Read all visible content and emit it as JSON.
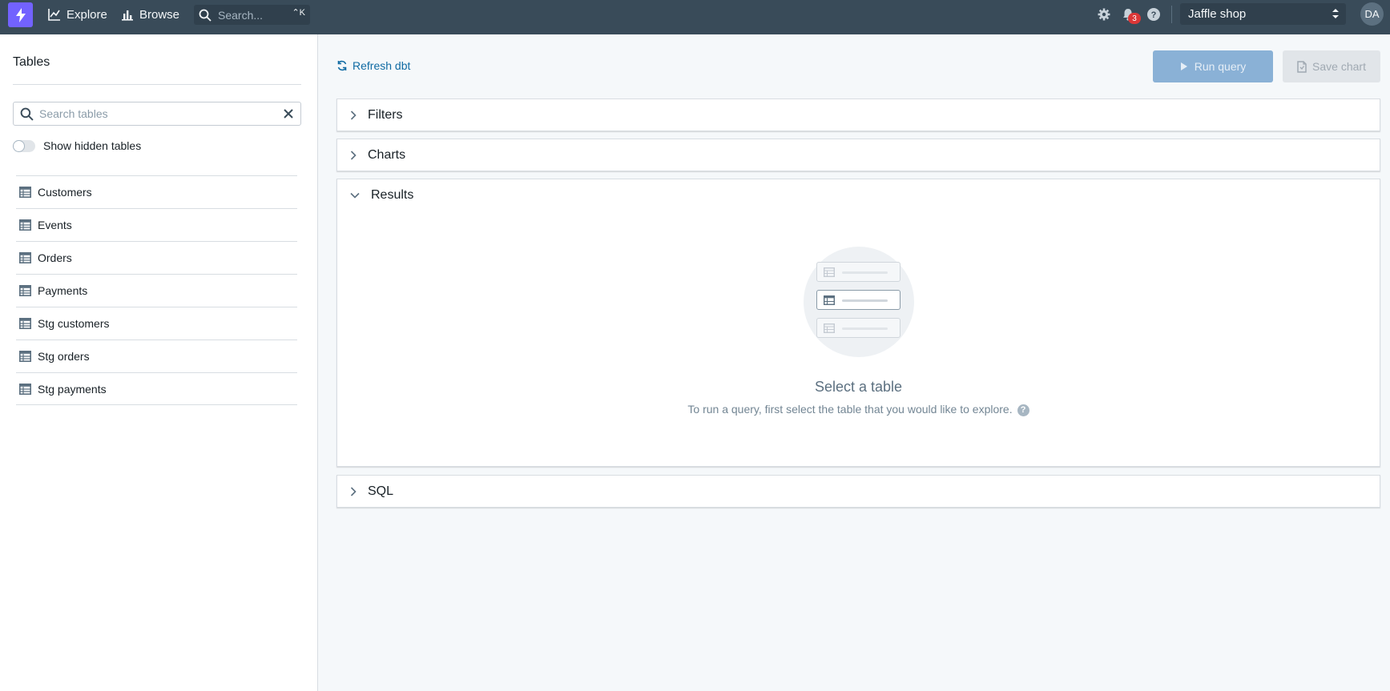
{
  "nav": {
    "explore_label": "Explore",
    "browse_label": "Browse",
    "search_placeholder": "Search...",
    "search_shortcut": "⌃K",
    "notification_count": "3",
    "project_name": "Jaffle shop",
    "user_initials": "DA"
  },
  "sidebar": {
    "title": "Tables",
    "search_placeholder": "Search tables",
    "show_hidden_label": "Show hidden tables",
    "show_hidden_on": false,
    "tables": [
      {
        "label": "Customers"
      },
      {
        "label": "Events"
      },
      {
        "label": "Orders"
      },
      {
        "label": "Payments"
      },
      {
        "label": "Stg customers"
      },
      {
        "label": "Stg orders"
      },
      {
        "label": "Stg payments"
      }
    ]
  },
  "main": {
    "refresh_label": "Refresh dbt",
    "run_query_label": "Run query",
    "save_chart_label": "Save chart",
    "sections": {
      "filters": "Filters",
      "charts": "Charts",
      "results": "Results",
      "sql": "SQL"
    },
    "empty_state": {
      "title": "Select a table",
      "description": "To run a query, first select the table that you would like to explore."
    }
  },
  "colors": {
    "nav_bg": "#394b59",
    "brand": "#7262ff",
    "primary_disabled": "#8ab1d6",
    "link": "#106ba3"
  }
}
